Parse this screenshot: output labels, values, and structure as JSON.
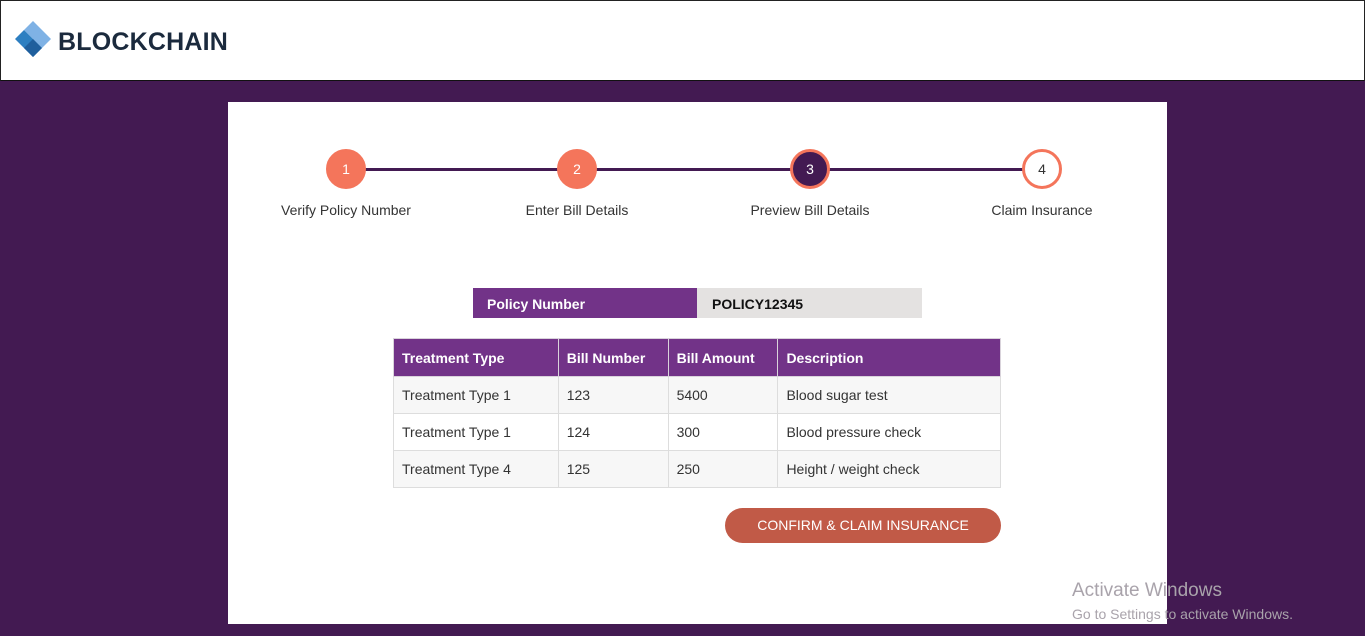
{
  "header": {
    "brand": "BLOCKCHAIN"
  },
  "steps": [
    {
      "num": "1",
      "label": "Verify Policy Number",
      "state": "done"
    },
    {
      "num": "2",
      "label": "Enter Bill Details",
      "state": "done"
    },
    {
      "num": "3",
      "label": "Preview Bill Details",
      "state": "active"
    },
    {
      "num": "4",
      "label": "Claim Insurance",
      "state": "todo"
    }
  ],
  "policy": {
    "label": "Policy Number",
    "value": "POLICY12345"
  },
  "table": {
    "headers": [
      "Treatment Type",
      "Bill Number",
      "Bill Amount",
      "Description"
    ],
    "rows": [
      [
        "Treatment Type 1",
        "123",
        "5400",
        "Blood sugar test"
      ],
      [
        "Treatment Type 1",
        "124",
        "300",
        "Blood pressure check"
      ],
      [
        "Treatment Type 4",
        "125",
        "250",
        "Height / weight check"
      ]
    ]
  },
  "actions": {
    "confirm_label": "CONFIRM & CLAIM INSURANCE"
  },
  "watermark": {
    "title": "Activate Windows",
    "subtitle": "Go to Settings to activate Windows."
  },
  "colors": {
    "background": "#431a52",
    "accent": "#f4755b",
    "header_purple": "#723388",
    "button": "#c15a47"
  }
}
